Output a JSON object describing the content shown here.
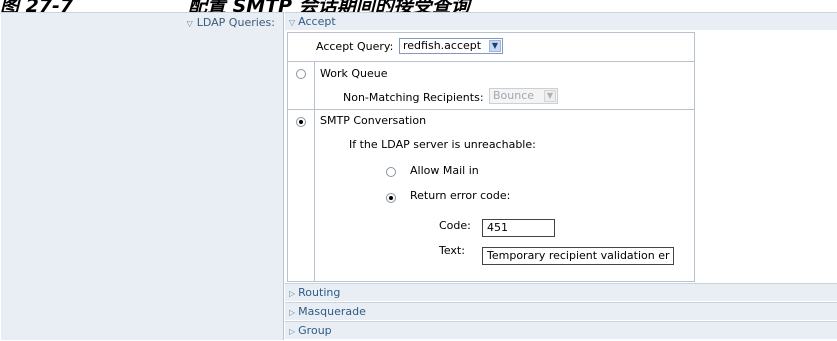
{
  "caption": {
    "figure_number": "图 27-7",
    "title": "配置 SMTP 会话期间的接受查询"
  },
  "ldap_queries_label": "LDAP Queries:",
  "sections": {
    "accept": "Accept",
    "routing": "Routing",
    "masquerade": "Masquerade",
    "group": "Group"
  },
  "accept": {
    "query_label": "Accept Query:",
    "query_value": "redfish.accept",
    "work_queue_label": "Work Queue",
    "work_queue_selected": false,
    "non_matching_label": "Non-Matching Recipients:",
    "non_matching_value": "Bounce",
    "smtp_label": "SMTP Conversation",
    "smtp_selected": true,
    "unreachable_label": "If the LDAP server is unreachable:",
    "allow_mail_label": "Allow Mail in",
    "allow_mail_selected": false,
    "return_error_label": "Return error code:",
    "return_error_selected": true,
    "code_label": "Code:",
    "code_value": "451",
    "text_label": "Text:",
    "text_value": "Temporary recipient validation er"
  },
  "icons": {
    "expanded": "triangle-down-icon",
    "collapsed": "triangle-right-icon",
    "dropdown": "chevron-down-icon"
  }
}
